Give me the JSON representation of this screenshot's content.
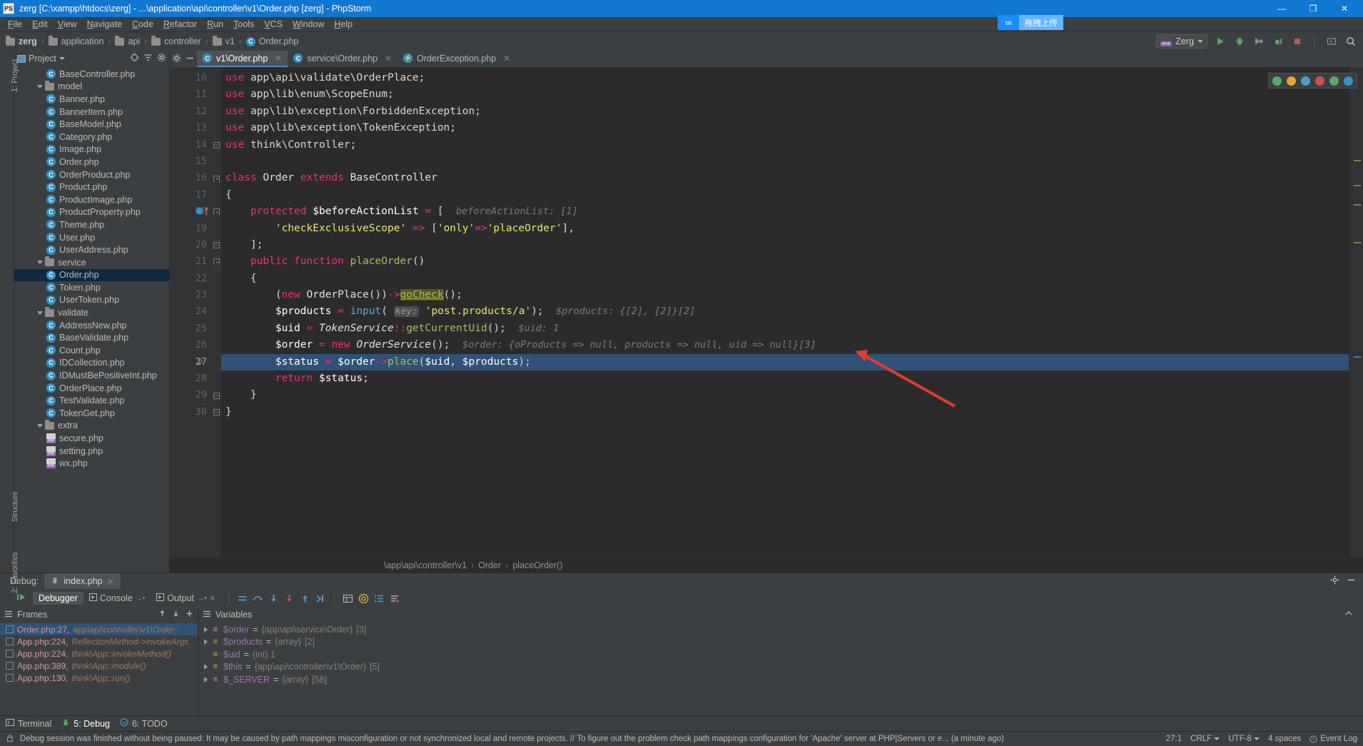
{
  "window": {
    "title": "zerg [C:\\xampp\\htdocs\\zerg] - ...\\application\\api\\controller\\v1\\Order.php [zerg] - PhpStorm",
    "icon": "phpstorm-logo-icon",
    "minimize": "—",
    "maximize": "❐",
    "close": "✕"
  },
  "menu": [
    "File",
    "Edit",
    "View",
    "Navigate",
    "Code",
    "Refactor",
    "Run",
    "Tools",
    "VCS",
    "Window",
    "Help"
  ],
  "breadcrumb": [
    {
      "label": "zerg",
      "type": "folder",
      "bold": true
    },
    {
      "label": "application",
      "type": "folder",
      "bold": false
    },
    {
      "label": "api",
      "type": "folder",
      "bold": false
    },
    {
      "label": "controller",
      "type": "folder",
      "bold": false
    },
    {
      "label": "v1",
      "type": "folder",
      "bold": false
    },
    {
      "label": "Order.php",
      "type": "php-class",
      "bold": false
    }
  ],
  "upload_tooltip": {
    "icon": "infinity-icon",
    "text": "拖拽上传"
  },
  "toolbar": {
    "run_config": "Zerg",
    "run_label": "Run",
    "debug_label": "Debug",
    "run_with_coverage_label": "Run with Coverage",
    "attach_debugger_label": "Attach debugger",
    "stop_label": "Stop",
    "hide_label": "Restore layout",
    "search_label": "Search everywhere"
  },
  "left_strip": {
    "project": "1: Project",
    "favorites": "2: Favorites",
    "structure": "Structure"
  },
  "project_panel": {
    "title": "Project",
    "locate_icon": "locate-icon",
    "collapse_icon": "collapse-all-icon",
    "settings_icon": "gear-icon",
    "hide_icon": "minimize-icon",
    "tree": [
      {
        "label": "BaseController.php",
        "type": "php-class",
        "indent": 3,
        "twisty": false,
        "selected": false
      },
      {
        "label": "model",
        "type": "folder",
        "indent": 2,
        "twisty": true,
        "selected": false
      },
      {
        "label": "Banner.php",
        "type": "php-class",
        "indent": 3,
        "twisty": false,
        "selected": false
      },
      {
        "label": "BannerItem.php",
        "type": "php-class",
        "indent": 3,
        "twisty": false,
        "selected": false
      },
      {
        "label": "BaseModel.php",
        "type": "php-class",
        "indent": 3,
        "twisty": false,
        "selected": false
      },
      {
        "label": "Category.php",
        "type": "php-class",
        "indent": 3,
        "twisty": false,
        "selected": false
      },
      {
        "label": "Image.php",
        "type": "php-class",
        "indent": 3,
        "twisty": false,
        "selected": false
      },
      {
        "label": "Order.php",
        "type": "php-class",
        "indent": 3,
        "twisty": false,
        "selected": false
      },
      {
        "label": "OrderProduct.php",
        "type": "php-class",
        "indent": 3,
        "twisty": false,
        "selected": false
      },
      {
        "label": "Product.php",
        "type": "php-class",
        "indent": 3,
        "twisty": false,
        "selected": false
      },
      {
        "label": "ProductImage.php",
        "type": "php-class",
        "indent": 3,
        "twisty": false,
        "selected": false
      },
      {
        "label": "ProductProperty.php",
        "type": "php-class",
        "indent": 3,
        "twisty": false,
        "selected": false
      },
      {
        "label": "Theme.php",
        "type": "php-class",
        "indent": 3,
        "twisty": false,
        "selected": false
      },
      {
        "label": "User.php",
        "type": "php-class",
        "indent": 3,
        "twisty": false,
        "selected": false
      },
      {
        "label": "UserAddress.php",
        "type": "php-class",
        "indent": 3,
        "twisty": false,
        "selected": false
      },
      {
        "label": "service",
        "type": "folder",
        "indent": 2,
        "twisty": true,
        "selected": false
      },
      {
        "label": "Order.php",
        "type": "php-class",
        "indent": 3,
        "twisty": false,
        "selected": true
      },
      {
        "label": "Token.php",
        "type": "php-class",
        "indent": 3,
        "twisty": false,
        "selected": false
      },
      {
        "label": "UserToken.php",
        "type": "php-class",
        "indent": 3,
        "twisty": false,
        "selected": false
      },
      {
        "label": "validate",
        "type": "folder",
        "indent": 2,
        "twisty": true,
        "selected": false
      },
      {
        "label": "AddressNew.php",
        "type": "php-class",
        "indent": 3,
        "twisty": false,
        "selected": false
      },
      {
        "label": "BaseValidate.php",
        "type": "php-class",
        "indent": 3,
        "twisty": false,
        "selected": false
      },
      {
        "label": "Count.php",
        "type": "php-class",
        "indent": 3,
        "twisty": false,
        "selected": false
      },
      {
        "label": "IDCollection.php",
        "type": "php-class",
        "indent": 3,
        "twisty": false,
        "selected": false
      },
      {
        "label": "IDMustBePositiveInt.php",
        "type": "php-class",
        "indent": 3,
        "twisty": false,
        "selected": false
      },
      {
        "label": "OrderPlace.php",
        "type": "php-class",
        "indent": 3,
        "twisty": false,
        "selected": false
      },
      {
        "label": "TestValidate.php",
        "type": "php-class",
        "indent": 3,
        "twisty": false,
        "selected": false
      },
      {
        "label": "TokenGet.php",
        "type": "php-class",
        "indent": 3,
        "twisty": false,
        "selected": false
      },
      {
        "label": "extra",
        "type": "folder",
        "indent": 2,
        "twisty": true,
        "selected": false
      },
      {
        "label": "secure.php",
        "type": "php-file",
        "indent": 3,
        "twisty": false,
        "selected": false
      },
      {
        "label": "setting.php",
        "type": "php-file",
        "indent": 3,
        "twisty": false,
        "selected": false
      },
      {
        "label": "wx.php",
        "type": "php-file",
        "indent": 3,
        "twisty": false,
        "selected": false
      }
    ]
  },
  "editor": {
    "tabs": [
      {
        "label": "v1\\Order.php",
        "icon": "php-class-icon",
        "active": true,
        "close": "✕"
      },
      {
        "label": "service\\Order.php",
        "icon": "php-class-icon",
        "active": false,
        "close": "✕"
      },
      {
        "label": "OrderException.php",
        "icon": "php-exception-icon",
        "active": false,
        "close": "✕"
      }
    ],
    "first_line": 10,
    "lines": [
      {
        "n": 10,
        "fold": "none",
        "indent": 1,
        "html": "<span class=\"kw2\">use</span> <span class=\"pl\">app\\api\\validate\\OrderPlace;</span>"
      },
      {
        "n": 11,
        "fold": "none",
        "indent": 1,
        "html": "<span class=\"kw2\">use</span> <span class=\"pl\">app\\lib\\enum\\ScopeEnum;</span>"
      },
      {
        "n": 12,
        "fold": "none",
        "indent": 1,
        "html": "<span class=\"kw2\">use</span> <span class=\"pl\">app\\lib\\exception\\ForbiddenException;</span>"
      },
      {
        "n": 13,
        "fold": "none",
        "indent": 1,
        "html": "<span class=\"kw2\">use</span> <span class=\"pl\">app\\lib\\exception\\TokenException;</span>"
      },
      {
        "n": 14,
        "fold": "end",
        "indent": 0,
        "html": "<span class=\"kw2\">use</span> <span class=\"pl\">think\\Controller;</span>"
      },
      {
        "n": 15,
        "fold": "none",
        "indent": 0,
        "html": ""
      },
      {
        "n": 16,
        "fold": "start",
        "indent": 0,
        "html": "<span class=\"kw2\">class</span> <span class=\"cls\">Order</span> <span class=\"kw2\">extends</span> <span class=\"cls\">BaseController</span>"
      },
      {
        "n": 17,
        "fold": "none",
        "indent": 0,
        "html": "<span class=\"pl\">{</span>"
      },
      {
        "n": 18,
        "fold": "start",
        "indent": 1,
        "html": "    <span class=\"kw2\">protected</span> <span class=\"var\">$beforeActionList</span> <span class=\"kw2\">=</span> <span class=\"pl\">[</span>  <span class=\"hint\">beforeActionList: [1]</span>",
        "breakpoint": true
      },
      {
        "n": 19,
        "fold": "none",
        "indent": 2,
        "html": "        <span class=\"str\">'checkExclusiveScope'</span> <span class=\"kw2\">=&gt;</span> <span class=\"pl\">[</span><span class=\"str\">'only'</span><span class=\"kw2\">=&gt;</span><span class=\"str\">'placeOrder'</span><span class=\"pl\">],</span>"
      },
      {
        "n": 20,
        "fold": "end",
        "indent": 1,
        "html": "    <span class=\"pl\">];</span>"
      },
      {
        "n": 21,
        "fold": "start",
        "indent": 1,
        "html": "    <span class=\"kw2\">public function</span> <span class=\"fn\">placeOrder</span><span class=\"pl\">()</span>"
      },
      {
        "n": 22,
        "fold": "none",
        "indent": 1,
        "html": "    <span class=\"pl\">{</span>"
      },
      {
        "n": 23,
        "fold": "none",
        "indent": 2,
        "html": "        <span class=\"pl\">(</span><span class=\"kw2\">new</span> <span class=\"cls\">OrderPlace</span><span class=\"pl\">())</span><span class=\"kw2\">-&gt;</span><span class=\"gocheck\">goCheck</span><span class=\"pl\">();</span>"
      },
      {
        "n": 24,
        "fold": "none",
        "indent": 2,
        "html": "        <span class=\"var\">$products</span> <span class=\"kw2\">=</span> <span class=\"fn\" style=\"color:#4eade5\">input</span><span class=\"pl\">(</span> <span class=\"param-hint\">key:</span> <span class=\"str\">'post.products/a'</span><span class=\"pl\">);</span>  <span class=\"hint\">$products: {[2], [2]}[2]</span>"
      },
      {
        "n": 25,
        "fold": "none",
        "indent": 2,
        "html": "        <span class=\"var\">$uid</span> <span class=\"kw2\">=</span> <span class=\"cls\" style=\"font-style:italic\">TokenService</span><span class=\"kw2\">::</span><span class=\"fn\">getCurrentUid</span><span class=\"pl\">();</span>  <span class=\"hint\">$uid: 1</span>"
      },
      {
        "n": 26,
        "fold": "none",
        "indent": 2,
        "html": "        <span class=\"var\">$order</span> <span class=\"kw2\">=</span> <span class=\"kw2\">new</span> <span class=\"cls\" style=\"font-style:italic\">OrderService</span><span class=\"pl\">();</span>  <span class=\"hint\">$order: {oProducts =&gt; null, products =&gt; null, uid =&gt; null}[3]</span>"
      },
      {
        "n": 27,
        "fold": "none",
        "indent": 2,
        "html": "        <span class=\"var\">$status</span> <span class=\"kw2\">=</span> <span class=\"var\">$order</span><span class=\"kw2\">-&gt;</span><span class=\"fn\">place</span><span class=\"pl\">(</span><span class=\"var\">$uid</span><span class=\"pl\">,</span> <span class=\"var\">$products</span><span class=\"pl\">);</span>",
        "current": true,
        "exec": true
      },
      {
        "n": 28,
        "fold": "none",
        "indent": 2,
        "html": "        <span class=\"kw2\">return</span> <span class=\"var\">$status</span><span class=\"pl\">;</span>"
      },
      {
        "n": 29,
        "fold": "end",
        "indent": 1,
        "html": "    <span class=\"pl\">}</span>"
      },
      {
        "n": 30,
        "fold": "end",
        "indent": 0,
        "html": "<span class=\"pl\">}</span>"
      }
    ],
    "bottom_breadcrumb": [
      "\\app\\api\\controller\\v1",
      "Order",
      "placeOrder()"
    ],
    "inspection_widget": [
      "inspections-ok-icon",
      "warning-icon",
      "error-icon",
      "php-icon",
      "validate-icon",
      "edit-icon"
    ]
  },
  "debug": {
    "label": "Debug:",
    "session_tab": "index.php",
    "session_close": "✕",
    "tabs": [
      {
        "label": "Debugger",
        "icon": "debugger-icon",
        "active": true
      },
      {
        "label": "Console",
        "icon": "console-icon",
        "active": false
      },
      {
        "label": "Output",
        "icon": "output-icon",
        "active": false
      }
    ],
    "toolbar_icons": [
      "resume-icon",
      "mute-breakpoints-icon",
      "step-over-icon",
      "step-into-icon",
      "force-step-into-icon",
      "step-out-icon",
      "run-to-cursor-icon",
      "evaluate-expression-icon",
      "at-icon",
      "watches-icon",
      "settings-icon"
    ],
    "frames_header": "Frames",
    "frames_up_icon": "arrow-up-icon",
    "frames_down_icon": "arrow-down-icon",
    "frames_add_icon": "plus-icon",
    "frames": [
      {
        "name": "Order.php:27,",
        "loc": "app\\api\\controller\\v1\\Order-",
        "selected": true
      },
      {
        "name": "App.php:224,",
        "loc": "ReflectionMethod->invokeArgs",
        "selected": false
      },
      {
        "name": "App.php:224,",
        "loc": "think\\App::invokeMethod()",
        "selected": false
      },
      {
        "name": "App.php:389,",
        "loc": "think\\App::module()",
        "selected": false
      },
      {
        "name": "App.php:130,",
        "loc": "think\\App::run()",
        "selected": false
      }
    ],
    "variables_header": "Variables",
    "variables": [
      {
        "name": "$order",
        "eq": "=",
        "value": "{app\\api\\service\\Order}",
        "count": "[3]",
        "expandable": true,
        "icon": "array-icon"
      },
      {
        "name": "$products",
        "eq": "=",
        "value": "{array}",
        "count": "[2]",
        "expandable": true,
        "icon": "array-icon"
      },
      {
        "name": "$uid",
        "eq": "=",
        "value": "{int} 1",
        "count": "",
        "expandable": false,
        "icon": "int-icon"
      },
      {
        "name": "$this",
        "eq": "=",
        "value": "{app\\api\\controller\\v1\\Order}",
        "count": "[5]",
        "expandable": true,
        "icon": "object-icon"
      },
      {
        "name": "$_SERVER",
        "eq": "=",
        "value": "{array}",
        "count": "[58]",
        "expandable": true,
        "icon": "array-icon"
      }
    ]
  },
  "tool_windows": [
    {
      "label": "Terminal",
      "icon": "terminal-icon",
      "active": false
    },
    {
      "label": "5: Debug",
      "icon": "debug-icon",
      "active": true
    },
    {
      "label": "6: TODO",
      "icon": "todo-icon",
      "active": false
    }
  ],
  "status_bar": {
    "message": "Debug session was finished without being paused: It may be caused by path mappings misconfiguration or not synchronized local and remote projects. // To figure out the problem check path mappings configuration for 'Apache' server at PHP|Servers or e... (a minute ago)",
    "caret_position": "27:1",
    "line_separator": "CRLF",
    "encoding": "UTF-8",
    "indent": "4 spaces",
    "event_log": "Event Log",
    "lock_icon": "lock-icon"
  },
  "colors": {
    "title_bar": "#1177d1",
    "chrome": "#3c3f41",
    "editor_bg": "#2b2b2b",
    "gutter_bg": "#313335",
    "selection": "#2f5277",
    "accent": "#4a88c7",
    "annotation_arrow": "#e03c31"
  }
}
